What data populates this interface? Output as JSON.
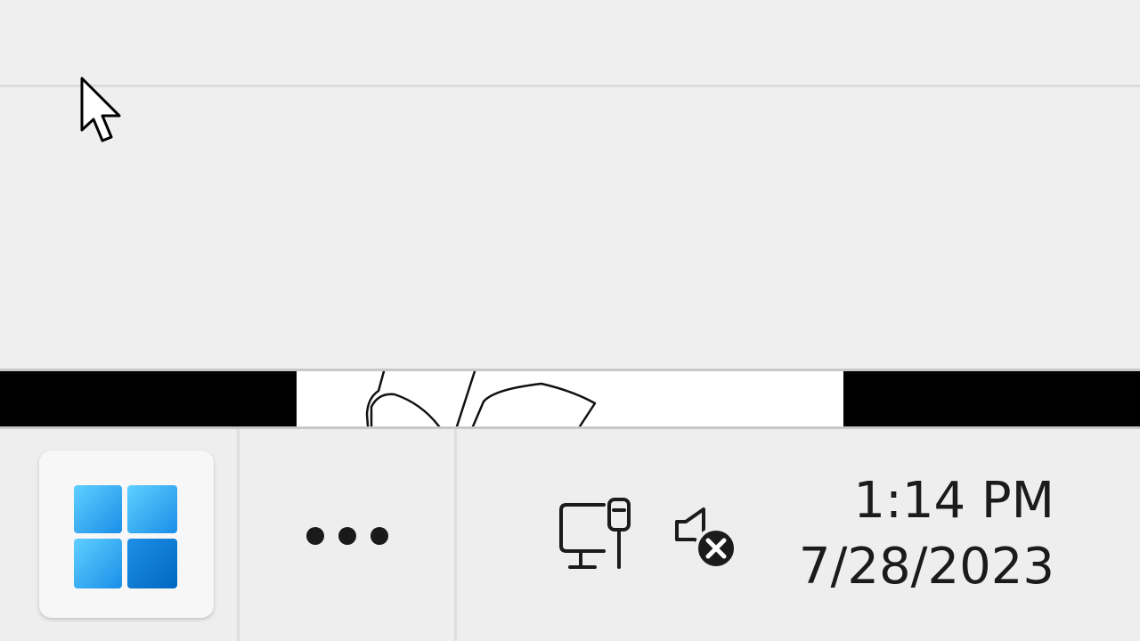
{
  "taskbar": {
    "start_button": {
      "icon": "windows-logo-icon"
    },
    "overflow_button": {
      "icon": "more-horizontal-icon"
    },
    "system_tray": {
      "network": {
        "icon": "wired-network-icon"
      },
      "volume": {
        "icon": "volume-muted-icon"
      }
    },
    "clock": {
      "time": "1:14 PM",
      "date": "7/28/2023"
    }
  },
  "cursor": {
    "icon": "arrow-pointer-icon"
  },
  "colors": {
    "background": "#efefef",
    "taskbar": "#eeeeee",
    "strip_background": "#000000",
    "preview_background": "#ffffff",
    "windows_logo_light": "#4cc2ff",
    "windows_logo_dark": "#0078d4",
    "text": "#1b1b1b"
  }
}
